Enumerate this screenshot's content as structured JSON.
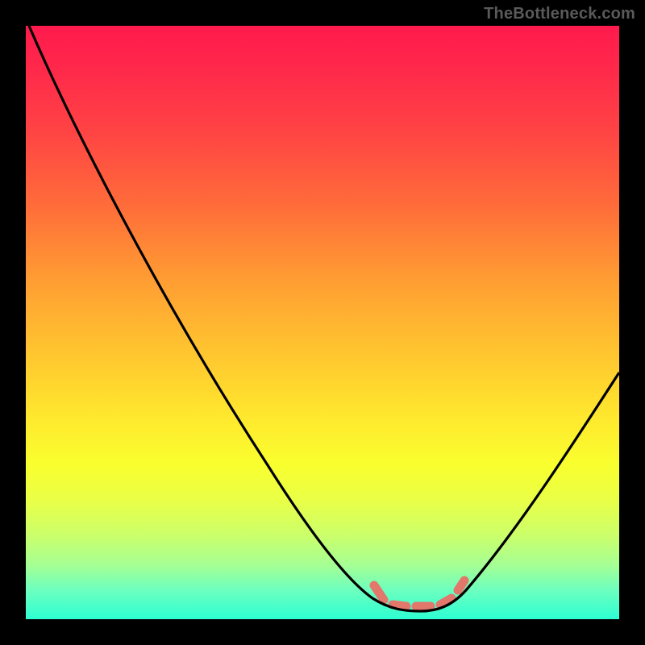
{
  "watermark": "TheBottleneck.com",
  "colors": {
    "frame": "#000000",
    "gradient_top": "#ff1a4d",
    "gradient_bottom": "#2dffd3",
    "curve": "#000000",
    "highlight": "#e2776c"
  },
  "chart_data": {
    "type": "line",
    "title": "",
    "xlabel": "",
    "ylabel": "",
    "xlim": [
      0,
      100
    ],
    "ylim": [
      0,
      100
    ],
    "series": [
      {
        "name": "curve",
        "x": [
          0,
          5,
          10,
          15,
          20,
          25,
          30,
          35,
          40,
          45,
          50,
          55,
          58,
          60,
          62,
          65,
          68,
          70,
          72,
          75,
          80,
          85,
          90,
          95,
          100
        ],
        "values": [
          100,
          92,
          83,
          75,
          66,
          58,
          49,
          41,
          33,
          25,
          17,
          10,
          6,
          4,
          3,
          2,
          2,
          2,
          3,
          5,
          11,
          20,
          30,
          41,
          52
        ]
      }
    ],
    "highlight_range_x": [
      58,
      72
    ],
    "grid": false,
    "legend": null
  }
}
